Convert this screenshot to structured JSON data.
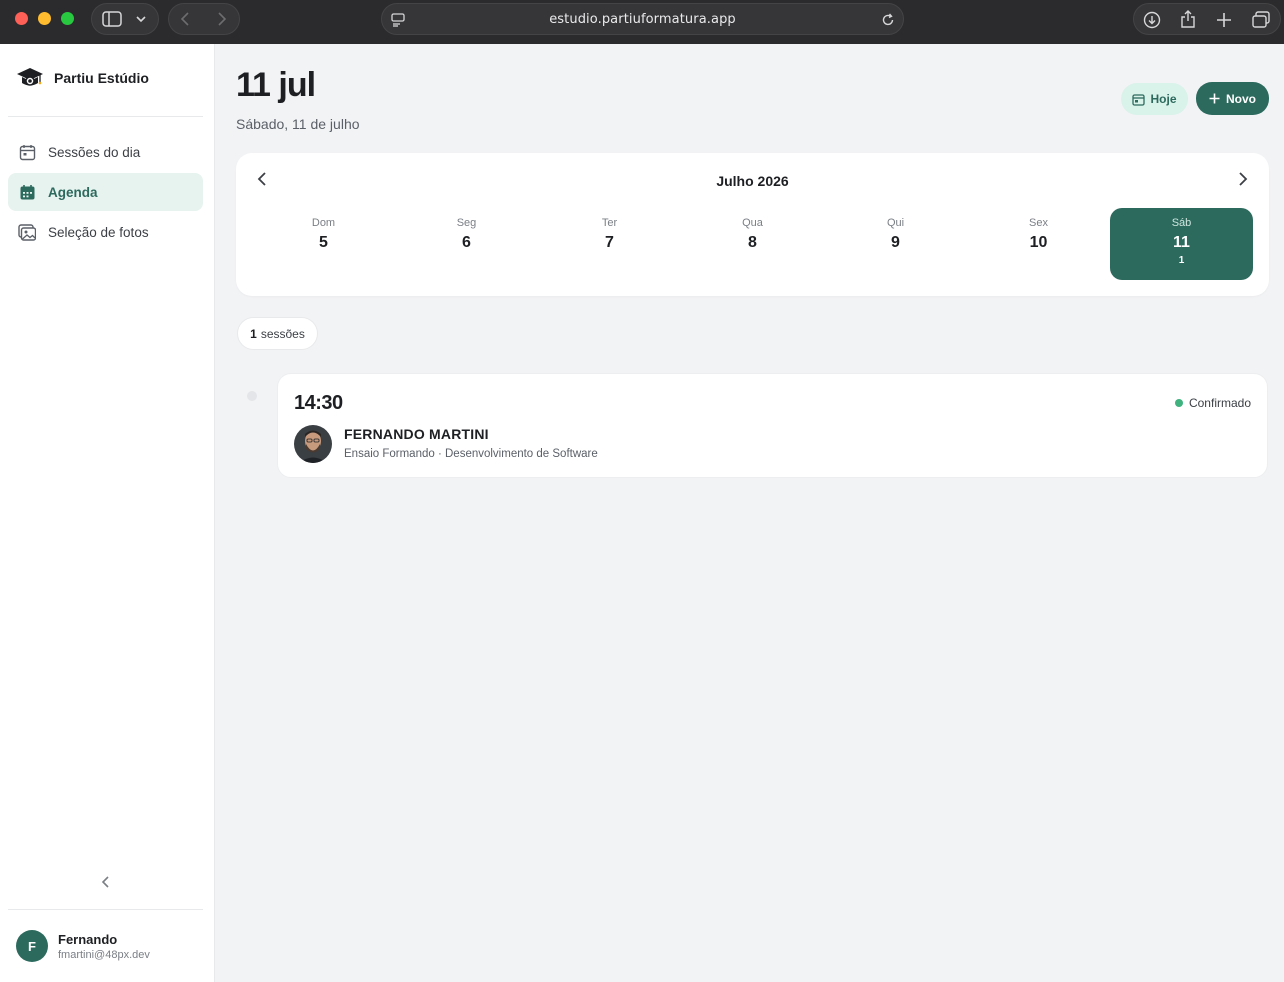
{
  "browser": {
    "url": "estudio.partiuformatura.app"
  },
  "brand": {
    "name": "Partiu Estúdio"
  },
  "sidebar": {
    "items": [
      {
        "label": "Sessões do dia",
        "icon": "calendar-outline-icon"
      },
      {
        "label": "Agenda",
        "icon": "calendar-filled-icon",
        "active": true
      },
      {
        "label": "Seleção de fotos",
        "icon": "photos-icon"
      }
    ],
    "collapse_icon": "chevron-left-icon"
  },
  "user": {
    "initial": "F",
    "name": "Fernando",
    "email": "fmartini@48px.dev"
  },
  "header": {
    "title": "11 jul",
    "subtitle": "Sábado, 11 de julho",
    "today_label": "Hoje",
    "new_label": "Novo"
  },
  "calendar": {
    "month_label": "Julho 2026",
    "days": [
      {
        "name": "Dom",
        "num": "5",
        "count": ""
      },
      {
        "name": "Seg",
        "num": "6",
        "count": ""
      },
      {
        "name": "Ter",
        "num": "7",
        "count": ""
      },
      {
        "name": "Qua",
        "num": "8",
        "count": ""
      },
      {
        "name": "Qui",
        "num": "9",
        "count": ""
      },
      {
        "name": "Sex",
        "num": "10",
        "count": ""
      },
      {
        "name": "Sáb",
        "num": "11",
        "count": "1"
      }
    ]
  },
  "sessions_summary": {
    "count": "1",
    "label": "sessões"
  },
  "session": {
    "time": "14:30",
    "status": "Confirmado",
    "client_name": "FERNANDO MARTINI",
    "description": "Ensaio Formando · Desenvolvimento de Software"
  },
  "colors": {
    "accent": "#2d6a5e",
    "accent_light": "#d9f2ea",
    "status_confirmed": "#3fb27f"
  }
}
